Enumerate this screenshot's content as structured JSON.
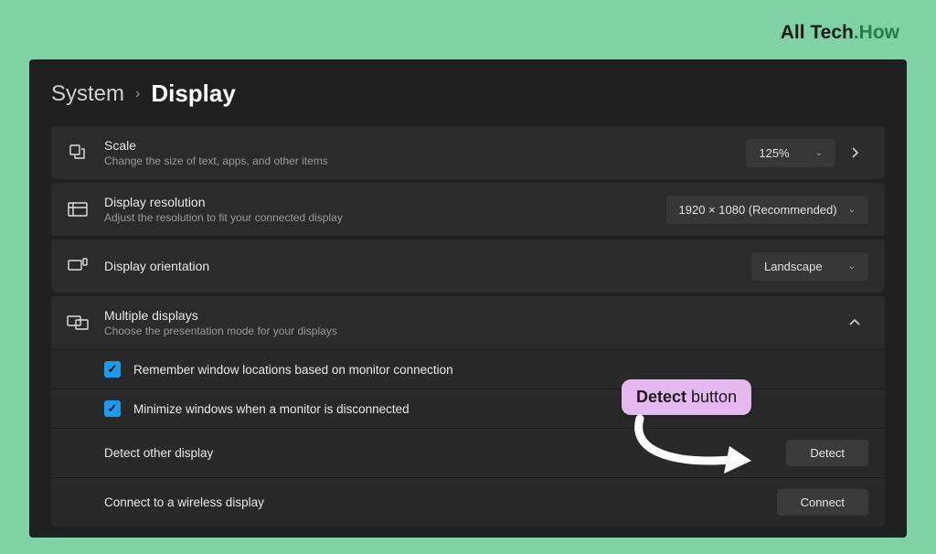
{
  "logo": {
    "part1": "All Tech",
    "part2": ".How"
  },
  "breadcrumb": {
    "system": "System",
    "display": "Display"
  },
  "scale": {
    "title": "Scale",
    "sub": "Change the size of text, apps, and other items",
    "value": "125%"
  },
  "resolution": {
    "title": "Display resolution",
    "sub": "Adjust the resolution to fit your connected display",
    "value": "1920 × 1080 (Recommended)"
  },
  "orientation": {
    "title": "Display orientation",
    "value": "Landscape"
  },
  "multiple": {
    "title": "Multiple displays",
    "sub": "Choose the presentation mode for your displays",
    "opt1": "Remember window locations based on monitor connection",
    "opt2": "Minimize windows when a monitor is disconnected",
    "detect_label": "Detect other display",
    "detect_button": "Detect",
    "connect_label": "Connect to a wireless display",
    "connect_button": "Connect"
  },
  "callout": {
    "bold": "Detect",
    "rest": " button"
  }
}
